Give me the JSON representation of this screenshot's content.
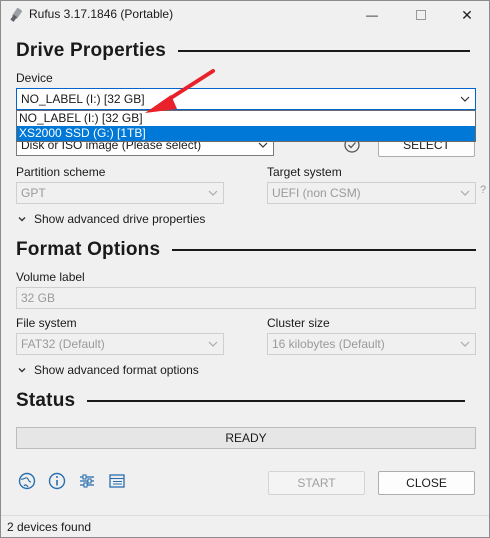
{
  "window": {
    "title": "Rufus 3.17.1846 (Portable)",
    "minimize_glyph": "—",
    "close_glyph": "✕"
  },
  "drive_properties": {
    "heading": "Drive Properties",
    "device_label": "Device",
    "device_value": "NO_LABEL (I:) [32 GB]",
    "device_options": [
      "NO_LABEL (I:) [32 GB]",
      "XS2000 SSD (G:) [1TB]"
    ],
    "selected_option_index": 1,
    "boot_selection_value": "Disk or ISO image (Please select)",
    "select_button": "SELECT",
    "partition_scheme_label": "Partition scheme",
    "partition_scheme_value": "GPT",
    "target_system_label": "Target system",
    "target_system_value": "UEFI (non CSM)",
    "help_glyph": "?",
    "advanced_toggle": "Show advanced drive properties"
  },
  "format_options": {
    "heading": "Format Options",
    "volume_label_label": "Volume label",
    "volume_label_value": "32 GB",
    "file_system_label": "File system",
    "file_system_value": "FAT32 (Default)",
    "cluster_size_label": "Cluster size",
    "cluster_size_value": "16 kilobytes (Default)",
    "advanced_toggle": "Show advanced format options"
  },
  "status": {
    "heading": "Status",
    "progress_text": "READY",
    "start_button": "START",
    "close_button": "CLOSE"
  },
  "toolbar_icons": [
    "globe-icon",
    "info-icon",
    "settings-sliders-icon",
    "log-icon"
  ],
  "statusbar": {
    "text": "2 devices found"
  },
  "colors": {
    "selection": "#0078d7",
    "annotation_arrow": "#e8212b"
  }
}
